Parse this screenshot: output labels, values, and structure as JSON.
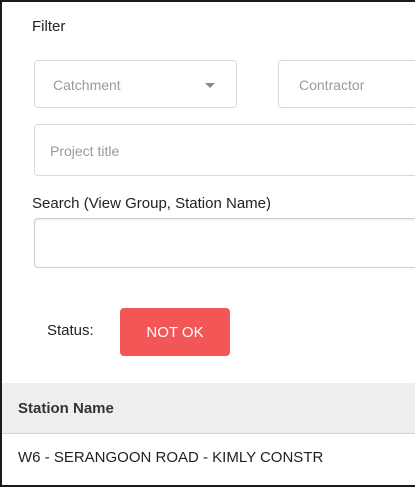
{
  "filter": {
    "title": "Filter",
    "catchment_placeholder": "Catchment",
    "contractor_placeholder": "Contractor",
    "project_title_placeholder": "Project title"
  },
  "search": {
    "label": "Search (View Group, Station Name)",
    "value": ""
  },
  "status": {
    "label": "Status:",
    "badge": "NOT OK",
    "badge_color": "#f35656"
  },
  "table": {
    "headers": [
      "Station Name"
    ],
    "rows": [
      [
        "W6 - SERANGOON ROAD - KIMLY CONSTR"
      ]
    ]
  }
}
